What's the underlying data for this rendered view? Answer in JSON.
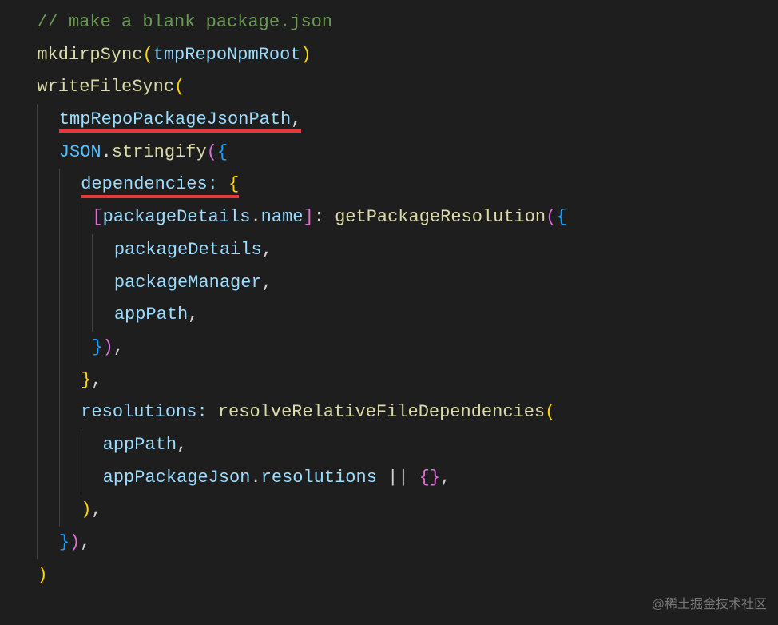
{
  "code": {
    "comment": "// make a blank package.json",
    "fn_mkdirpSync": "mkdirpSync",
    "arg_tmpRepoNpmRoot": "tmpRepoNpmRoot",
    "fn_writeFileSync": "writeFileSync",
    "arg_tmpRepoPackageJsonPath": "tmpRepoPackageJsonPath",
    "obj_JSON": "JSON",
    "fn_stringify": "stringify",
    "key_dependencies": "dependencies:",
    "expr_packageDetails": "packageDetails",
    "prop_name": "name",
    "fn_getPackageResolution": "getPackageResolution",
    "short_packageDetails": "packageDetails",
    "short_packageManager": "packageManager",
    "short_appPath": "appPath",
    "key_resolutions": "resolutions:",
    "fn_resolveRelativeFileDependencies": "resolveRelativeFileDependencies",
    "arg_appPath": "appPath",
    "arg_appPackageJson": "appPackageJson",
    "prop_resolutions": "resolutions",
    "op_or": "||",
    "empty_obj_open": "{",
    "empty_obj_close": "}"
  },
  "watermark": "@稀土掘金技术社区"
}
